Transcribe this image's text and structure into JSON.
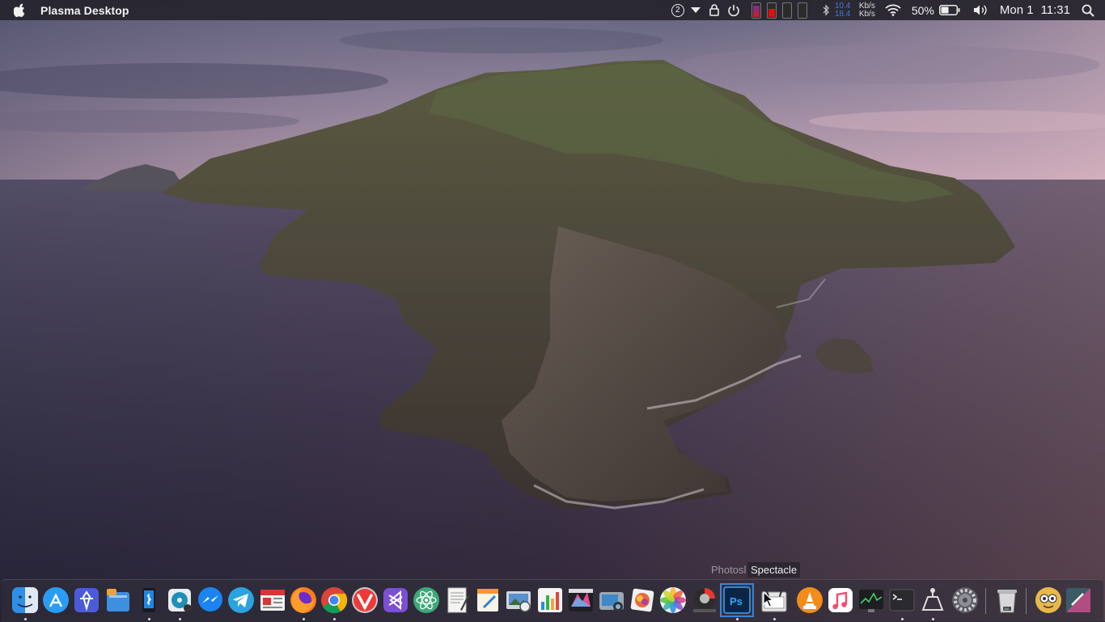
{
  "menubar": {
    "app_name": "Plasma Desktop",
    "notification_count": "2",
    "network": {
      "up_value": "10.4",
      "up_unit": "Kb/s",
      "down_value": "18.4",
      "down_unit": "Kb/s"
    },
    "battery_percent": "50%",
    "battery_level": 0.5,
    "date": "Mon 1",
    "time": "11:31"
  },
  "tooltips": {
    "back": "Photosl",
    "front": "Spectacle"
  },
  "dock_items": [
    "finder-icon",
    "app-store-icon",
    "plasma-discover-icon",
    "files-icon",
    "kde-connect-icon",
    "disk-burner-icon",
    "messenger-icon",
    "telegram-icon",
    "news-reader-icon",
    "firefox-icon",
    "chrome-icon",
    "vivaldi-icon",
    "visual-studio-code-icon",
    "atom-icon",
    "text-editor-icon",
    "pages-icon",
    "preview-icon",
    "numbers-icon",
    "final-cut-icon",
    "image-capture-icon",
    "photo-editor-icon",
    "photos-icon",
    "photoscape-icon",
    "photoshop-icon",
    "spectacle-icon",
    "vlc-icon",
    "music-icon",
    "system-monitor-icon",
    "terminal-icon",
    "network-icon",
    "system-preferences-icon",
    "trash-icon",
    "user-avatar-icon",
    "kde-app-icon"
  ],
  "colors": {
    "menubar": "#26242c",
    "dock": "#302f3a",
    "accent": "#3d7bd8"
  }
}
